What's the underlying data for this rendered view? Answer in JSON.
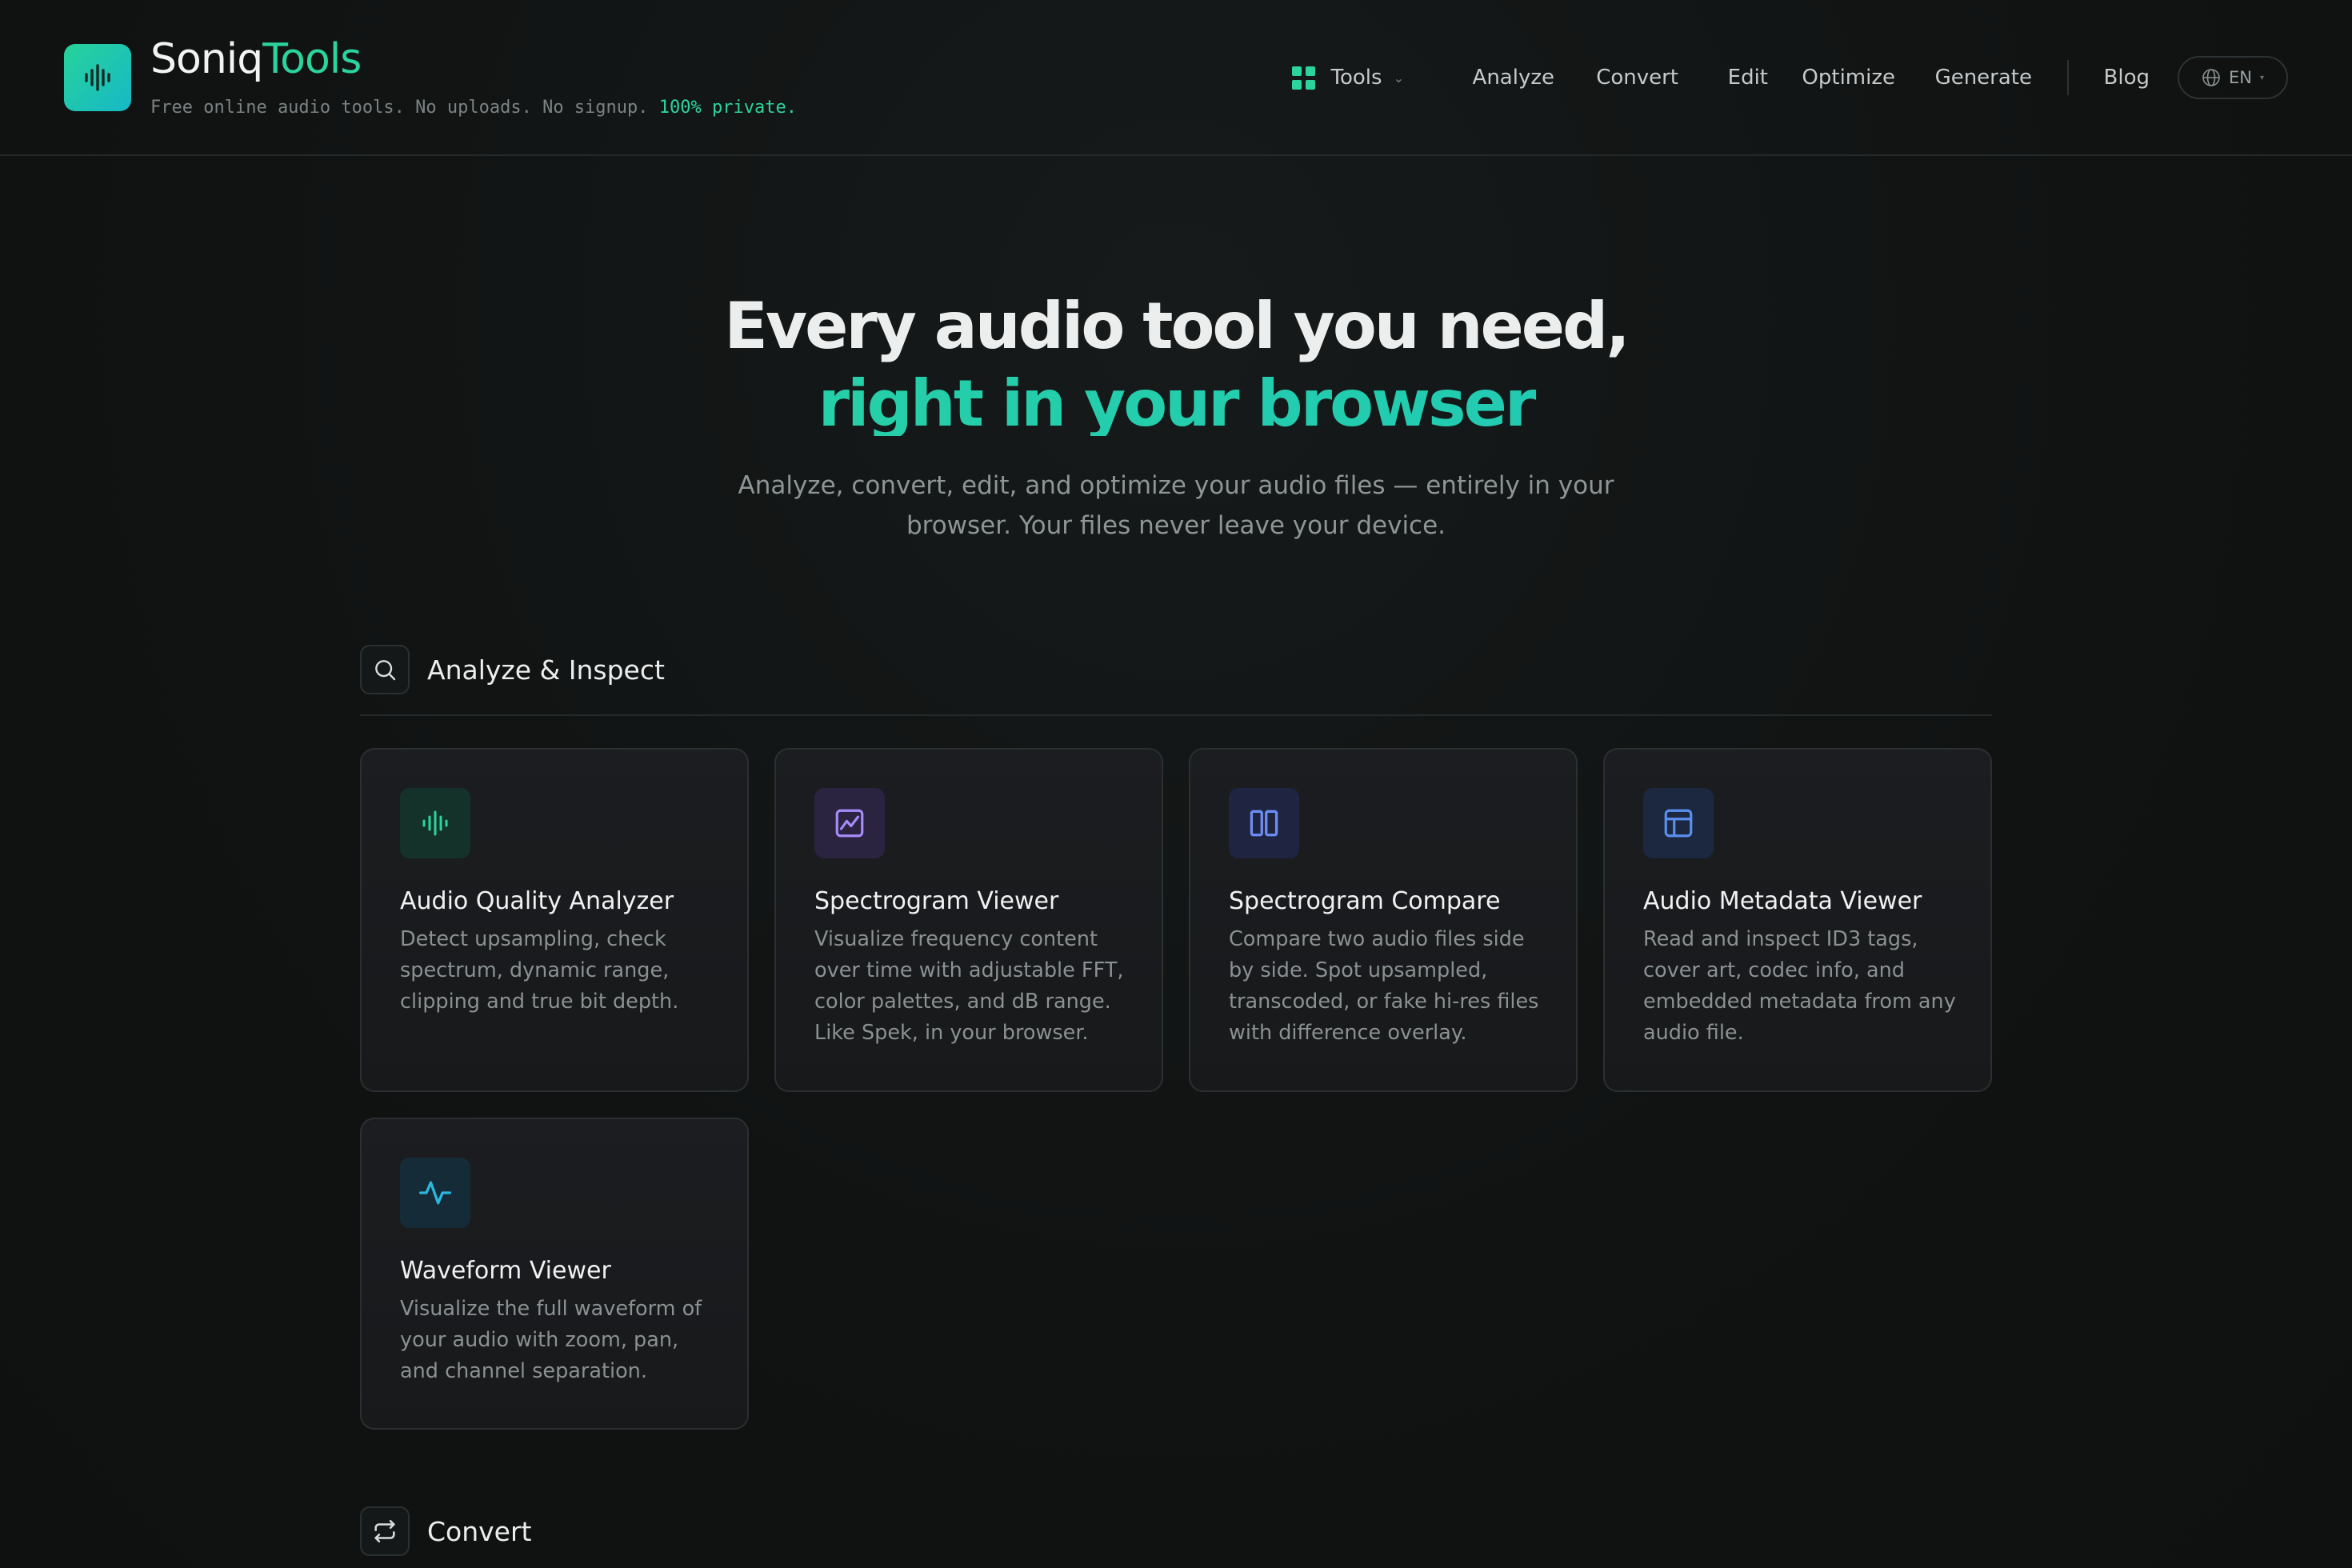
{
  "header": {
    "brand_part1": "Soniq",
    "brand_part2": "Tools",
    "tagline": "Free online audio tools. No uploads. No signup.",
    "tagline_accent": "100% private.",
    "nav": {
      "tools": "Tools",
      "analyze": "Analyze",
      "convert": "Convert",
      "edit": "Edit",
      "optimize": "Optimize",
      "generate": "Generate",
      "blog": "Blog",
      "language": "EN"
    }
  },
  "hero": {
    "line1": "Every audio tool you need,",
    "line2": "right in your browser",
    "subtitle": "Analyze, convert, edit, and optimize your audio files — entirely in your browser. Your files never leave your device."
  },
  "sections": [
    {
      "title": "Analyze & Inspect",
      "icon": "search-icon",
      "cards": [
        {
          "title": "Audio Quality Analyzer",
          "desc": "Detect upsampling, check spectrum, dynamic range, clipping and true bit depth.",
          "icon": "waveform-bars-icon",
          "color": "#2bd49c"
        },
        {
          "title": "Spectrogram Viewer",
          "desc": "Visualize frequency content over time with adjustable FFT, color palettes, and dB range. Like Spek, in your browser.",
          "icon": "image-chart-icon",
          "color": "#a78bfa"
        },
        {
          "title": "Spectrogram Compare",
          "desc": "Compare two audio files side by side. Spot upsampled, transcoded, or fake hi-res files with difference overlay.",
          "icon": "columns-icon",
          "color": "#6d8cf2"
        },
        {
          "title": "Audio Metadata Viewer",
          "desc": "Read and inspect ID3 tags, cover art, codec info, and embedded metadata from any audio file.",
          "icon": "layout-icon",
          "color": "#5b8ff0"
        },
        {
          "title": "Waveform Viewer",
          "desc": "Visualize the full waveform of your audio with zoom, pan, and channel separation.",
          "icon": "pulse-icon",
          "color": "#2ab8e0"
        }
      ]
    },
    {
      "title": "Convert",
      "icon": "repeat-icon"
    }
  ]
}
